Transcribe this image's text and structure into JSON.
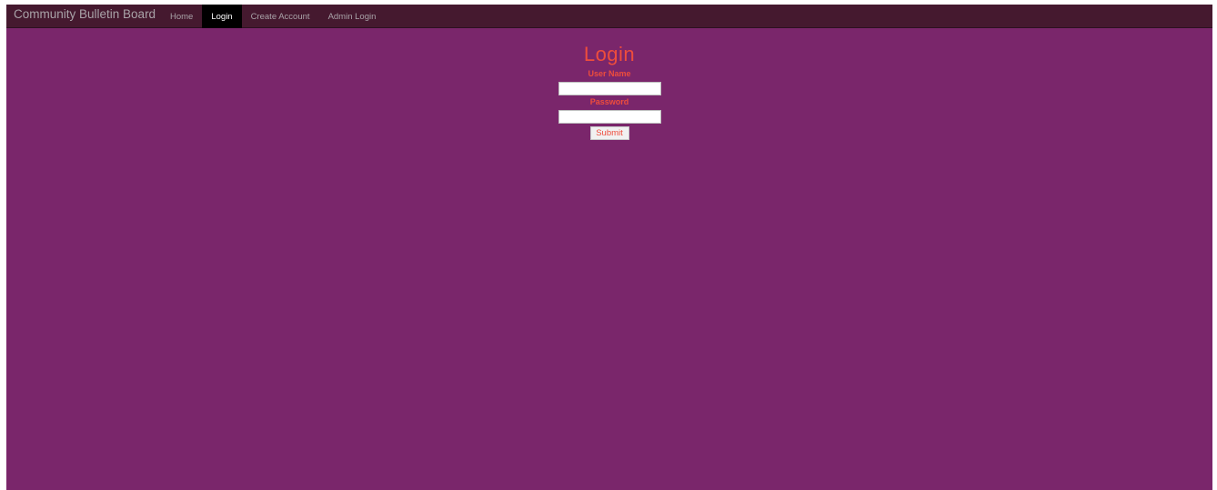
{
  "navbar": {
    "brand": "Community Bulletin Board",
    "items": [
      {
        "label": "Home",
        "active": false
      },
      {
        "label": "Login",
        "active": true
      },
      {
        "label": "Create Account",
        "active": false
      },
      {
        "label": "Admin Login",
        "active": false
      }
    ]
  },
  "login": {
    "title": "Login",
    "username_label": "User Name",
    "username_value": "",
    "password_label": "Password",
    "password_value": "",
    "submit_label": "Submit"
  },
  "colors": {
    "background": "#7a266b",
    "navbar": "#45192f",
    "accent": "#ee4d3c",
    "active_nav": "#000000"
  }
}
